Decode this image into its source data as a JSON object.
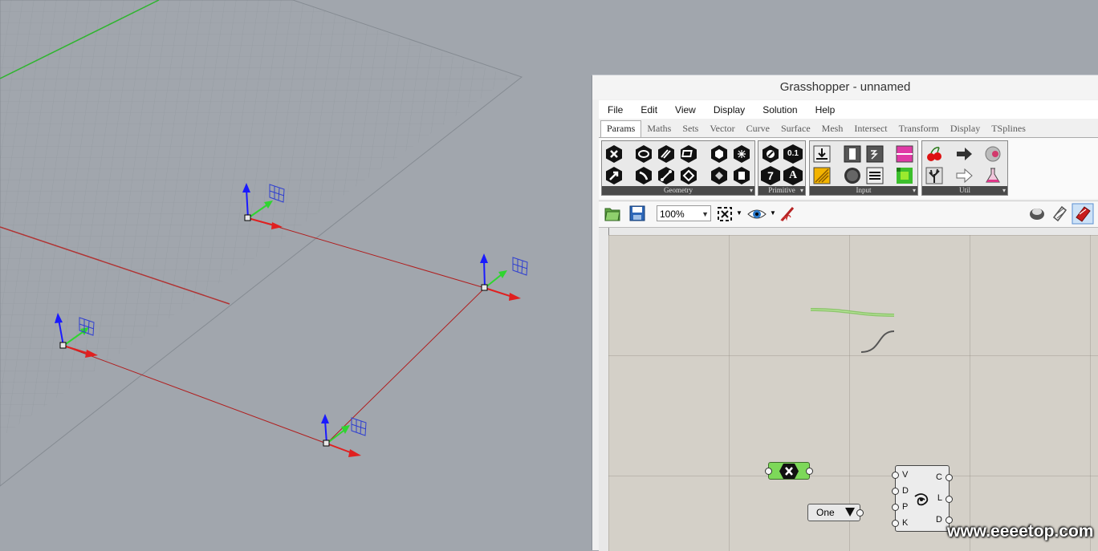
{
  "viewport": {
    "grid_color": "#8f959c",
    "x_axis_color": "#b03434",
    "y_axis_color": "#2fb52f"
  },
  "grasshopper": {
    "title": "Grasshopper - unnamed",
    "menu": [
      "File",
      "Edit",
      "View",
      "Display",
      "Solution",
      "Help"
    ],
    "tabs": [
      "Params",
      "Maths",
      "Sets",
      "Vector",
      "Curve",
      "Surface",
      "Mesh",
      "Intersect",
      "Transform",
      "Display",
      "TSplines"
    ],
    "active_tab": "Params",
    "ribbon_groups": [
      "Geometry",
      "Primitive",
      "Input",
      "Util"
    ],
    "primitive_labels": {
      "decimal": "0.1",
      "integer": "7",
      "text": "A"
    },
    "zoom": "100%",
    "canvas": {
      "value_list_label": "One",
      "component_inputs": [
        "V",
        "D",
        "P",
        "K"
      ],
      "component_outputs": [
        "C",
        "L",
        "D"
      ]
    }
  },
  "watermark": "www.eeeetop.com"
}
